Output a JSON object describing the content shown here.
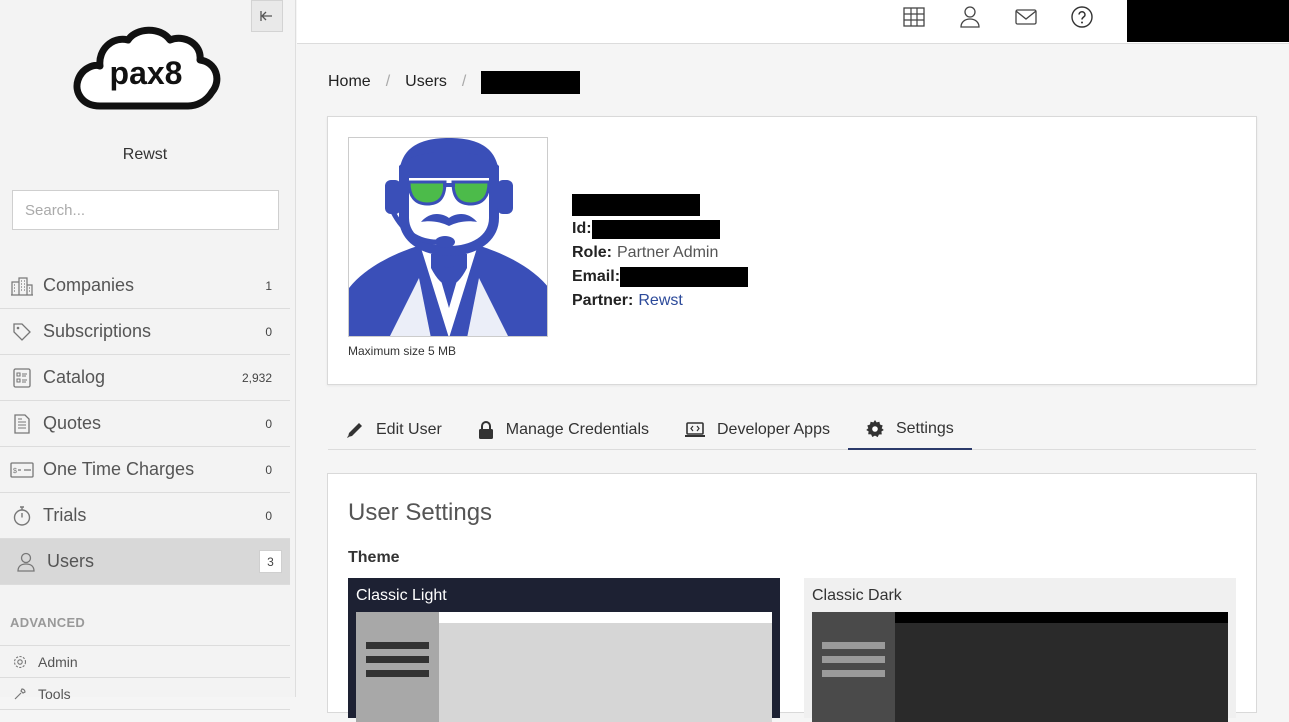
{
  "sidebar": {
    "org_name": "Rewst",
    "logo_text": "pax8",
    "search_placeholder": "Search...",
    "items": [
      {
        "label": "Companies",
        "count": "1",
        "icon": "buildings-icon"
      },
      {
        "label": "Subscriptions",
        "count": "0",
        "icon": "tag-icon"
      },
      {
        "label": "Catalog",
        "count": "2,932",
        "icon": "catalog-list-icon"
      },
      {
        "label": "Quotes",
        "count": "0",
        "icon": "document-icon"
      },
      {
        "label": "One Time Charges",
        "count": "0",
        "icon": "dollar-ticket-icon"
      },
      {
        "label": "Trials",
        "count": "0",
        "icon": "stopwatch-icon"
      },
      {
        "label": "Users",
        "count": "3",
        "icon": "user-icon",
        "active": true
      }
    ],
    "section_label": "ADVANCED",
    "advanced_items": [
      {
        "label": "Admin",
        "icon": "gear-icon"
      },
      {
        "label": "Tools",
        "icon": "wrench-icon"
      }
    ]
  },
  "topbar": {
    "icons": [
      "grid-table-icon",
      "user-icon",
      "mail-icon",
      "help-icon"
    ]
  },
  "breadcrumb": {
    "home": "Home",
    "users": "Users"
  },
  "profile": {
    "max_size_note": "Maximum size 5 MB",
    "id_label": "Id:",
    "role_label": "Role:",
    "role_value": "Partner Admin",
    "email_label": "Email:",
    "partner_label": "Partner:",
    "partner_value": "Rewst"
  },
  "tabs": [
    {
      "label": "Edit User",
      "icon": "pencil-icon"
    },
    {
      "label": "Manage Credentials",
      "icon": "lock-icon"
    },
    {
      "label": "Developer Apps",
      "icon": "laptop-code-icon"
    },
    {
      "label": "Settings",
      "icon": "gear-icon",
      "active": true
    }
  ],
  "settings": {
    "title": "User Settings",
    "theme_label": "Theme",
    "themes": [
      {
        "name": "Classic Light"
      },
      {
        "name": "Classic Dark"
      }
    ]
  },
  "colors": {
    "accent": "#2c3a6a",
    "link": "#2c4a9a",
    "avatar_bg": "#3a4fb8",
    "avatar_glasses": "#4cbb4a"
  }
}
